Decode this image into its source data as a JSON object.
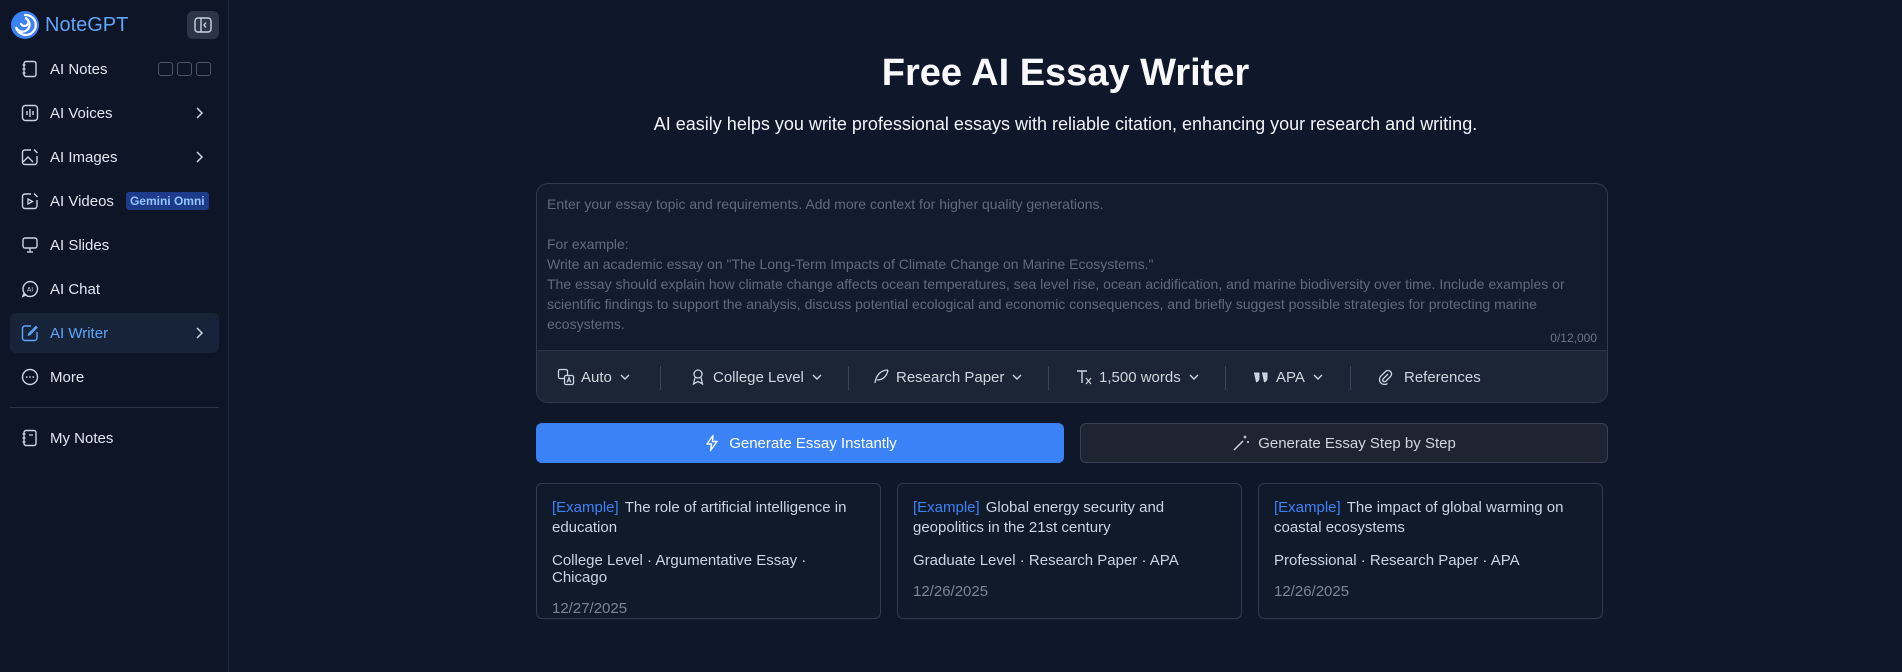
{
  "brand": {
    "name": "NoteGPT",
    "accent": "#60a5fa"
  },
  "sidebar": {
    "items": [
      {
        "label": "AI Notes",
        "icon": "notebook-icon"
      },
      {
        "label": "AI Voices",
        "icon": "waveform-icon"
      },
      {
        "label": "AI Images",
        "icon": "image-edit-icon"
      },
      {
        "label": "AI Videos",
        "icon": "video-edit-icon",
        "badge": "Gemini Omni"
      },
      {
        "label": "AI Slides",
        "icon": "presentation-icon"
      },
      {
        "label": "AI Chat",
        "icon": "ai-chat-icon"
      },
      {
        "label": "AI Writer",
        "icon": "pen-write-icon",
        "active": true
      },
      {
        "label": "More",
        "icon": "more-dots-icon"
      },
      {
        "label": "My Notes",
        "icon": "notes-book-icon"
      }
    ]
  },
  "main": {
    "title": "Free AI Essay Writer",
    "subtitle": "AI easily helps you write professional essays with reliable citation, enhancing your research and writing.",
    "editor": {
      "placeholder": "Enter your essay topic and requirements. Add more context for higher quality generations.\n\nFor example:\nWrite an academic essay on \"The Long-Term Impacts of Climate Change on Marine Ecosystems.\"\nThe essay should explain how climate change affects ocean temperatures, sea level rise, ocean acidification, and marine biodiversity over time. Include examples or scientific findings to support the analysis, discuss potential ecological and economic consequences, and briefly suggest possible strategies for protecting marine ecosystems.",
      "char_count": "0/12,000"
    },
    "options": {
      "language": "Auto",
      "level": "College Level",
      "type": "Research Paper",
      "length": "1,500 words",
      "citation": "APA",
      "references": "References"
    },
    "buttons": {
      "instant": "Generate Essay Instantly",
      "step": "Generate Essay Step by Step"
    },
    "examples": [
      {
        "tag": "[Example]",
        "title": "The role of artificial intelligence in education",
        "meta": "College Level · Argumentative Essay · Chicago",
        "date": "12/27/2025"
      },
      {
        "tag": "[Example]",
        "title": "Global energy security and geopolitics in the 21st century",
        "meta": "Graduate Level · Research Paper · APA",
        "date": "12/26/2025"
      },
      {
        "tag": "[Example]",
        "title": "The impact of global warming on coastal ecosystems",
        "meta": "Professional · Research Paper · APA",
        "date": "12/26/2025"
      }
    ]
  }
}
